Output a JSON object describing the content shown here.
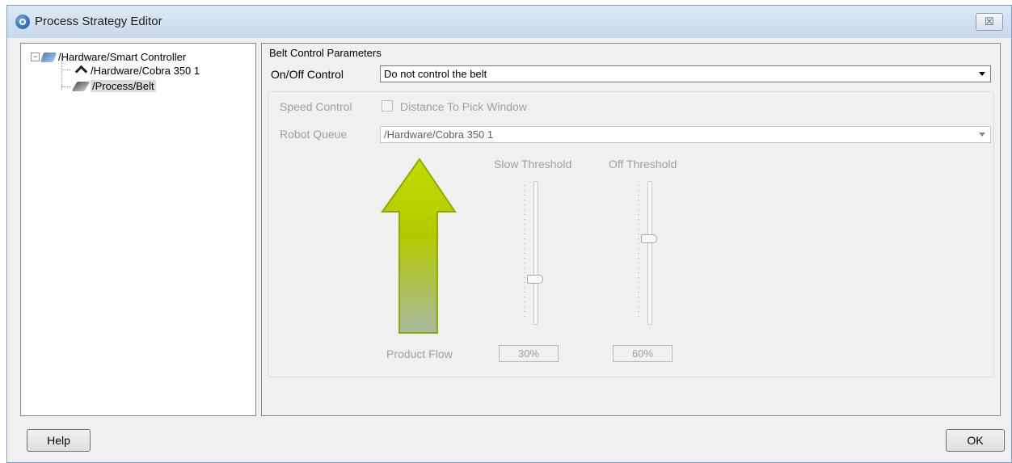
{
  "window": {
    "title": "Process Strategy Editor",
    "close_glyph": "☒"
  },
  "tree": {
    "items": [
      {
        "label": "/Hardware/Smart Controller",
        "icon": "controller-icon",
        "expander": "−"
      },
      {
        "label": "/Hardware/Cobra 350 1",
        "icon": "robot-icon"
      },
      {
        "label": "/Process/Belt",
        "icon": "belt-icon",
        "selected": true
      }
    ]
  },
  "params": {
    "group_title": "Belt Control Parameters",
    "onoff_label": "On/Off Control",
    "onoff_value": "Do not control the belt",
    "speed_label": "Speed Control",
    "speed_checkbox_label": "Distance To Pick Window",
    "speed_checked": false,
    "queue_label": "Robot Queue",
    "queue_value": "/Hardware/Cobra 350 1",
    "product_flow_label": "Product Flow",
    "slow_threshold_label": "Slow Threshold",
    "slow_threshold_value": "30%",
    "slow_threshold_level": 0.3,
    "off_threshold_label": "Off Threshold",
    "off_threshold_value": "60%",
    "off_threshold_level": 0.6
  },
  "buttons": {
    "help": "Help",
    "ok": "OK"
  },
  "colors": {
    "arrow_fill_top": "#b8d400",
    "arrow_fill_bottom": "#a6b89a",
    "arrow_border": "#8fa800",
    "title_bar": "#d4e1f1"
  }
}
